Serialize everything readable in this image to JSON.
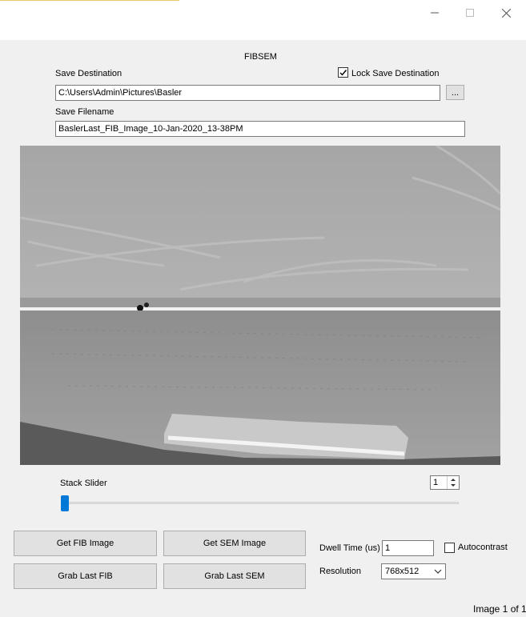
{
  "window": {
    "minimize_icon": "minimize-icon",
    "maximize_icon": "maximize-icon",
    "close_icon": "close-icon"
  },
  "header": {
    "title": "FIBSEM"
  },
  "save": {
    "destination_label": "Save Destination",
    "lock_label": "Lock Save Destination",
    "lock_checked": true,
    "destination_value": "C:\\Users\\Admin\\Pictures\\Basler",
    "browse_label": "...",
    "filename_label": "Save Filename",
    "filename_value": "BaslerLast_FIB_Image_10-Jan-2020_13-38PM"
  },
  "stack": {
    "slider_label": "Stack Slider",
    "spinner_value": "1",
    "slider_position": 0
  },
  "buttons": {
    "get_fib": "Get FIB Image",
    "get_sem": "Get SEM Image",
    "grab_fib": "Grab Last FIB",
    "grab_sem": "Grab Last SEM"
  },
  "settings": {
    "dwell_label": "Dwell Time (us)",
    "dwell_value": "1",
    "autocontrast_label": "Autocontrast",
    "autocontrast_checked": false,
    "resolution_label": "Resolution",
    "resolution_value": "768x512"
  },
  "status": {
    "image_counter": "Image 1 of 1"
  }
}
